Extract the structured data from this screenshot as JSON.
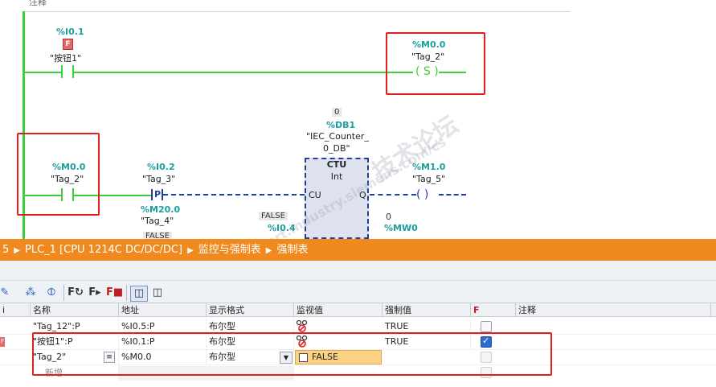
{
  "ladder": {
    "comment_label": "注释",
    "rung1": {
      "contact_addr": "%I0.1",
      "contact_tag": "\"按钮1\"",
      "force_badge": "F",
      "coil_addr": "%M0.0",
      "coil_tag": "\"Tag_2\"",
      "coil_symbol": "( S )"
    },
    "rung2": {
      "contact1_addr": "%M0.0",
      "contact1_tag": "\"Tag_2\"",
      "contact2_addr": "%I0.2",
      "contact2_tag": "\"Tag_3\"",
      "p_label": "P",
      "m_addr": "%M20.0",
      "m_tag": "\"Tag_4\"",
      "m_value": "FALSE",
      "counter_value": "0",
      "counter_db": "%DB1",
      "counter_db_name_1": "\"IEC_Counter_",
      "counter_db_name_2": "0_DB\"",
      "block_title": "CTU",
      "block_type": "Int",
      "pin_cu": "CU",
      "pin_q": "Q",
      "input_value": "FALSE",
      "input_addr": "%I0.4",
      "out_addr": "%M1.0",
      "out_tag": "\"Tag_5\"",
      "coil_symbol": "(   )",
      "cv_value": "0",
      "cv_addr": "%MW0"
    },
    "watermark_main": "技术论坛",
    "watermark_sub": "support.industry.siemens.com/cs"
  },
  "panel": {
    "breadcrumb": [
      "5",
      "PLC_1 [CPU 1214C DC/DC/DC]",
      "监控与强制表",
      "强制表"
    ],
    "columns": [
      "名称",
      "地址",
      "显示格式",
      "监视值",
      "强制值",
      "F",
      "注释"
    ],
    "rows": [
      {
        "name": "\"Tag_12\":P",
        "address": "%I0.5:P",
        "format": "布尔型",
        "monitor": "",
        "force_value": "TRUE",
        "force": false
      },
      {
        "name": "\"按钮1\":P",
        "address": "%I0.1:P",
        "format": "布尔型",
        "monitor": "",
        "force_value": "TRUE",
        "force": true
      },
      {
        "name": "\"Tag_2\"",
        "address": "%M0.0",
        "format": "布尔型",
        "monitor": "FALSE",
        "force_value": "",
        "force": false
      }
    ],
    "new_row_label": "新增",
    "gutter_f": "F"
  },
  "colors": {
    "wire_green": "#3ccf3c",
    "address_teal": "#1a9e9e",
    "highlight_red": "#e02020",
    "title_orange": "#f0891e",
    "monitor_cell": "#fcd283"
  }
}
